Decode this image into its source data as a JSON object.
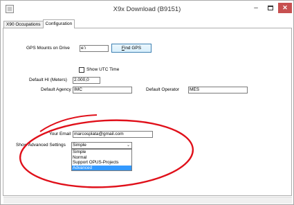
{
  "window": {
    "title": "X9x Download  (B9151)",
    "minimize_glyph": "–",
    "close_glyph": "✕"
  },
  "tabs": [
    {
      "label": "X90 Occupations",
      "active": false
    },
    {
      "label": "Configuration",
      "active": true
    }
  ],
  "config": {
    "gps_mounts_label": "GPS Mounts on Drive",
    "gps_mounts_value": "e:\\",
    "find_gps_button_hotkey": "F",
    "find_gps_button_rest": "ind GPS",
    "show_utc_label": "Show UTC Time",
    "show_utc_checked": false,
    "default_hi_label": "Default HI (Meters)",
    "default_hi_value": "2.000,0",
    "default_agency_label": "Default Agency",
    "default_agency_value": "IMC",
    "default_operator_label": "Default Operator",
    "default_operator_value": "MES",
    "email_label": "Your Email",
    "email_value": "marcosplata@gmail.com",
    "advanced_label": "Show Advanced Settings",
    "advanced_selected": "Simple",
    "advanced_options": [
      "Simple",
      "Normal",
      "Support OPUS-Projects",
      "Advanced"
    ],
    "advanced_highlighted": "Advanced"
  },
  "annotation": {
    "shape": "ellipse",
    "color": "#e0101a"
  }
}
